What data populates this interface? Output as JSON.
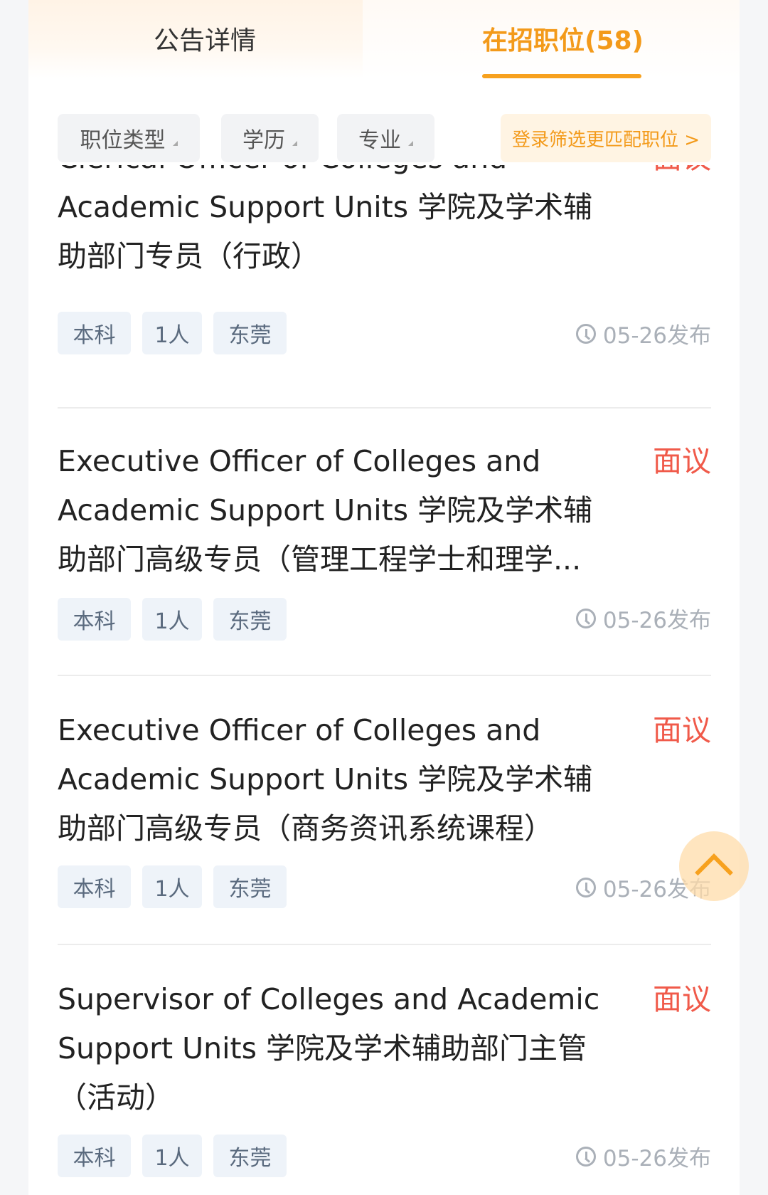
{
  "tabs": {
    "notice": "公告详情",
    "jobs": "在招职位(58)"
  },
  "filters": {
    "job_type": "职位类型",
    "education": "学历",
    "major": "专业",
    "login_prompt": "登录筛选更匹配职位 >"
  },
  "jobs": [
    {
      "title": "Clerical Officer of Colleges and Academic Support Units 学院及学术辅助部门专员（行政）",
      "salary": "面议",
      "tags": [
        "本科",
        "1人",
        "东莞"
      ],
      "date": "05-26发布"
    },
    {
      "title": "Executive Officer of Colleges and Academic Support Units 学院及学术辅助部门高级专员（管理工程学士和理学...",
      "salary": "面议",
      "tags": [
        "本科",
        "1人",
        "东莞"
      ],
      "date": "05-26发布"
    },
    {
      "title": "Executive Officer of Colleges and Academic Support Units 学院及学术辅助部门高级专员（商务资讯系统课程）",
      "salary": "面议",
      "tags": [
        "本科",
        "1人",
        "东莞"
      ],
      "date": "05-26发布"
    },
    {
      "title": "Supervisor of Colleges and Academic Support Units 学院及学术辅助部门主管（活动）",
      "salary": "面议",
      "tags": [
        "本科",
        "1人",
        "东莞"
      ],
      "date": "05-26发布"
    }
  ],
  "colors": {
    "accent": "#f7a11e",
    "salary": "#f05a4a",
    "tag_bg": "#eef3f9"
  },
  "icons": {
    "clock": "clock-icon",
    "back_to_top": "chevron-up-icon",
    "filter_arrow": "triangle-down-icon"
  }
}
